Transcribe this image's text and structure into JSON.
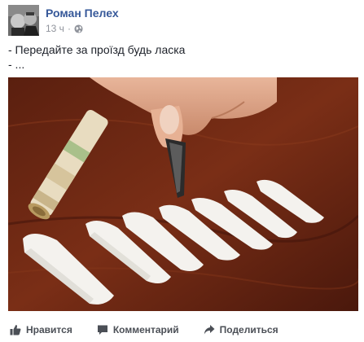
{
  "post": {
    "author": "Роман Пелех",
    "time": "13 ч",
    "separator": "·",
    "text_lines": [
      "- Передайте за проїзд будь ласка",
      "- ..."
    ]
  },
  "actions": {
    "like_label": "Нравится",
    "comment_label": "Комментарий",
    "share_label": "Поделиться"
  },
  "colors": {
    "author_link": "#365899",
    "meta_gray": "#90949c",
    "action_gray": "#4b4f56"
  },
  "icons": {
    "privacy": "globe-icon",
    "like": "thumbs-up-icon",
    "comment": "comment-bubble-icon",
    "share": "share-arrow-icon"
  }
}
